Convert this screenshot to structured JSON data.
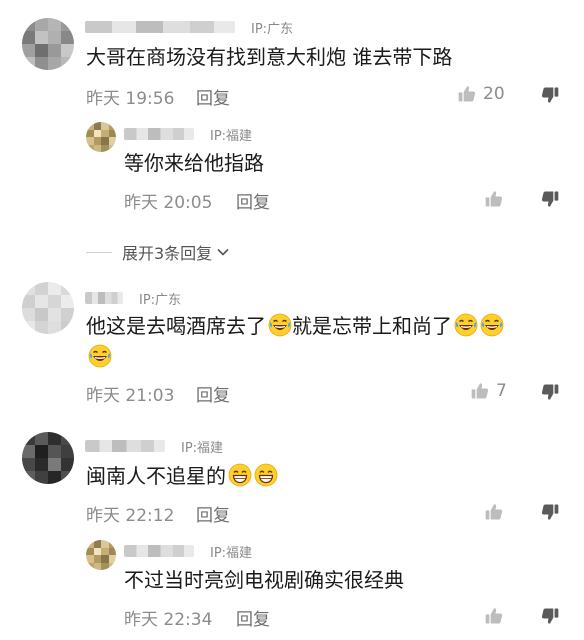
{
  "comments": [
    {
      "ip": "IP:广东",
      "text": "大哥在商场没有找到意大利炮 谁去带下路",
      "time": "昨天 19:56",
      "reply": "回复",
      "likes": "20",
      "icons": {
        "like": "thumbs-up-icon",
        "dislike": "thumbs-down-icon"
      }
    },
    {
      "ip": "IP:福建",
      "text": "等你来给他指路",
      "time": "昨天 20:05",
      "reply": "回复"
    },
    {
      "expand": "展开3条回复"
    },
    {
      "ip": "IP:广东",
      "text": "他这是去喝酒席去了",
      "text_2": "就是忘带上和尚了",
      "time": "昨天 21:03",
      "reply": "回复",
      "likes": "7",
      "emoji": "laughing-tears-emoji"
    },
    {
      "ip": "IP:福建",
      "text": "闽南人不追星的",
      "time": "昨天 22:12",
      "reply": "回复",
      "emoji": "grinning-emoji"
    },
    {
      "ip": "IP:福建",
      "text": "不过当时亮剑电视剧确实很经典",
      "time": "昨天 22:34",
      "reply": "回复"
    }
  ]
}
